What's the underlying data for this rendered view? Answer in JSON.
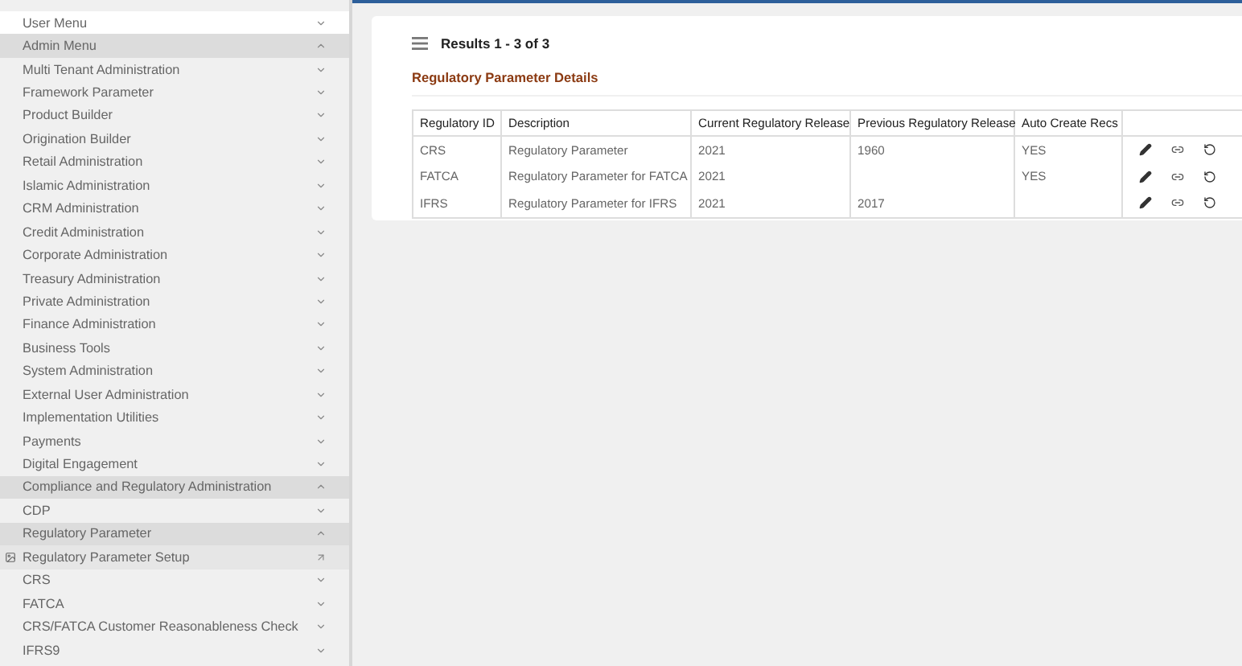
{
  "sidebar": {
    "items": [
      {
        "label": "User Menu",
        "kind": "top",
        "expanded": false
      },
      {
        "label": "Admin Menu",
        "kind": "group",
        "expanded": true
      },
      {
        "label": "Multi Tenant Administration",
        "kind": "group",
        "expanded": false
      },
      {
        "label": "Framework Parameter",
        "kind": "group",
        "expanded": false
      },
      {
        "label": "Product Builder",
        "kind": "group",
        "expanded": false
      },
      {
        "label": "Origination Builder",
        "kind": "group",
        "expanded": false
      },
      {
        "label": "Retail Administration",
        "kind": "group",
        "expanded": false
      },
      {
        "label": "Islamic Administration",
        "kind": "group",
        "expanded": false
      },
      {
        "label": "CRM Administration",
        "kind": "group",
        "expanded": false
      },
      {
        "label": "Credit Administration",
        "kind": "group",
        "expanded": false
      },
      {
        "label": "Corporate Administration",
        "kind": "group",
        "expanded": false
      },
      {
        "label": "Treasury Administration",
        "kind": "group",
        "expanded": false
      },
      {
        "label": "Private Administration",
        "kind": "group",
        "expanded": false
      },
      {
        "label": "Finance Administration",
        "kind": "group",
        "expanded": false
      },
      {
        "label": "Business Tools",
        "kind": "group",
        "expanded": false
      },
      {
        "label": "System Administration",
        "kind": "group",
        "expanded": false
      },
      {
        "label": "External User Administration",
        "kind": "group",
        "expanded": false
      },
      {
        "label": "Implementation Utilities",
        "kind": "group",
        "expanded": false
      },
      {
        "label": "Payments",
        "kind": "group",
        "expanded": false
      },
      {
        "label": "Digital Engagement",
        "kind": "group",
        "expanded": false
      },
      {
        "label": "Compliance and Regulatory Administration",
        "kind": "group",
        "expanded": true
      },
      {
        "label": "CDP",
        "kind": "group",
        "expanded": false
      },
      {
        "label": "Regulatory Parameter",
        "kind": "group",
        "expanded": true
      },
      {
        "label": "Regulatory Parameter Setup",
        "kind": "page"
      },
      {
        "label": "CRS",
        "kind": "group",
        "expanded": false
      },
      {
        "label": "FATCA",
        "kind": "group",
        "expanded": false
      },
      {
        "label": "CRS/FATCA Customer Reasonableness Check",
        "kind": "group",
        "expanded": false
      },
      {
        "label": "IFRS9",
        "kind": "group",
        "expanded": false
      }
    ]
  },
  "results": {
    "count": "Results 1 - 3 of 3",
    "section_title": "Regulatory Parameter Details"
  },
  "table": {
    "columns": [
      "Regulatory ID",
      "Description",
      "Current Regulatory Release",
      "Previous Regulatory Release",
      "Auto Create Recs"
    ],
    "rows": [
      [
        "CRS",
        "Regulatory Parameter",
        "2021",
        "1960",
        "YES"
      ],
      [
        "FATCA",
        "Regulatory Parameter for FATCA",
        "2021",
        "",
        "YES"
      ],
      [
        "IFRS",
        "Regulatory Parameter for IFRS",
        "2021",
        "2017",
        ""
      ]
    ]
  }
}
